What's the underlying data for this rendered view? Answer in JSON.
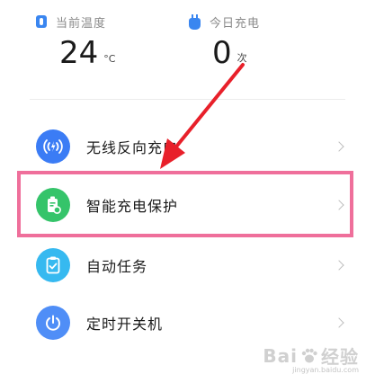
{
  "stats": {
    "temperature": {
      "label": "当前温度",
      "value": "24",
      "unit": "°C",
      "icon": "thermometer-icon"
    },
    "charge_count": {
      "label": "今日充电",
      "value": "0",
      "unit": "次",
      "icon": "plug-icon"
    }
  },
  "menu": {
    "items": [
      {
        "label": "无线反向充电",
        "icon": "wireless-charge-icon",
        "color": "#3b7cf5"
      },
      {
        "label": "智能充电保护",
        "icon": "battery-shield-icon",
        "color": "#35c46a"
      },
      {
        "label": "自动任务",
        "icon": "clipboard-check-icon",
        "color": "#36b9f0"
      },
      {
        "label": "定时开关机",
        "icon": "power-icon",
        "color": "#4f8ef7"
      }
    ]
  },
  "annotation": {
    "highlight_color": "#ef6f9b",
    "arrow_color": "#e8202a"
  },
  "watermark": {
    "brand_left": "Bai",
    "brand_right": "经验",
    "url": "jingyan.baidu.com"
  }
}
